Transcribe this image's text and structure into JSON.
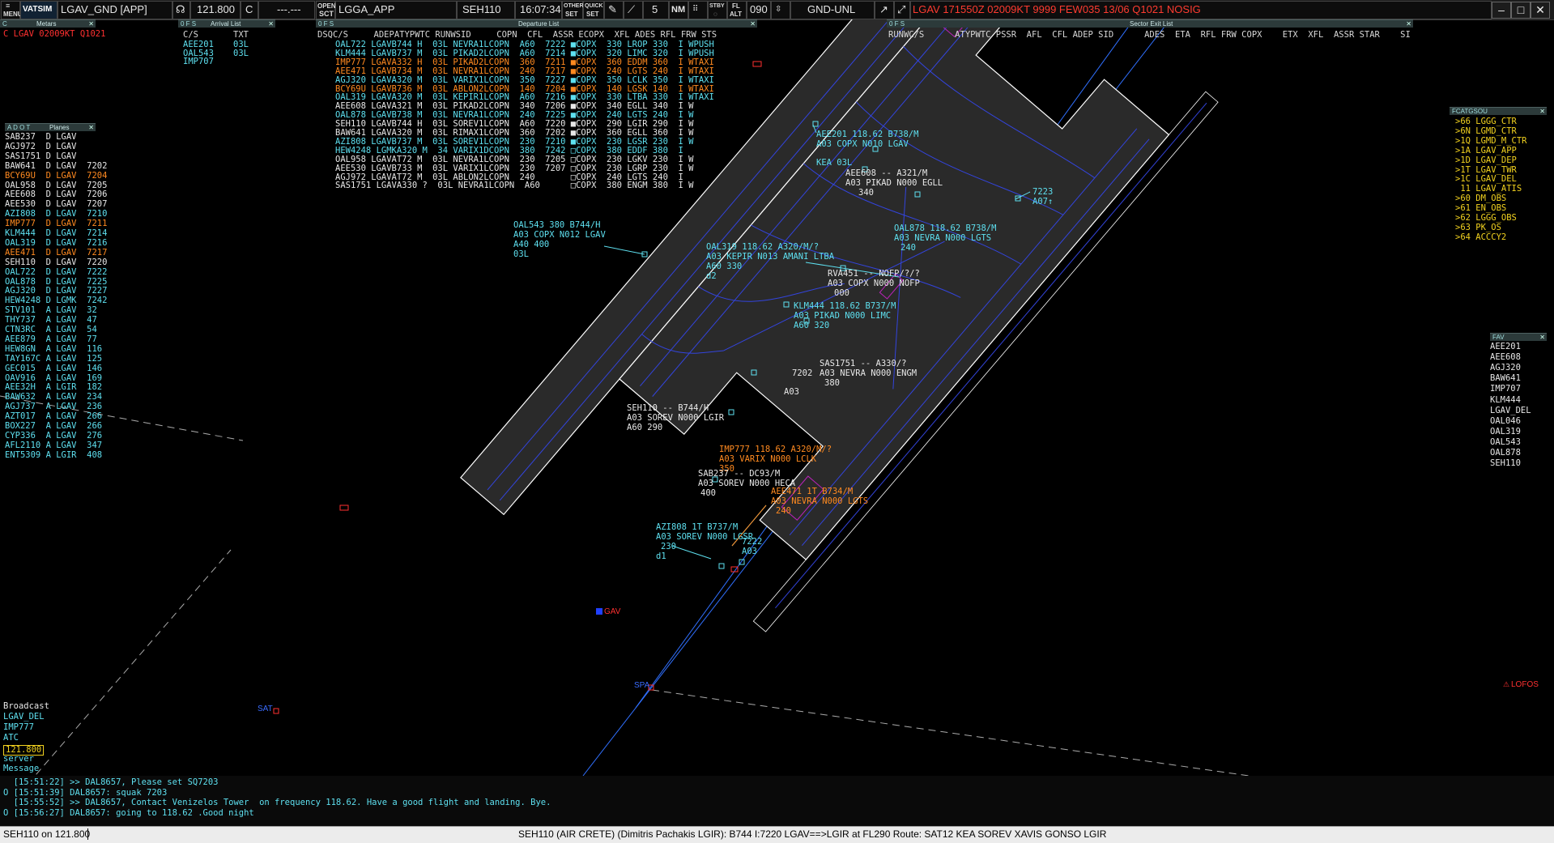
{
  "toolbar": {
    "menu_label": "MENU",
    "logo": "VATSIM",
    "position": "LGAV_GND [APP]",
    "frequency": "121.800",
    "freq_mode": "C",
    "freq_aux": "---.---",
    "open_label": "OPEN",
    "sct_label": "SCT",
    "sector_file": "LGGA_APP",
    "selected_callsign": "SEH110",
    "time": "16:07:34",
    "other_label": "OTHER",
    "set_label": "SET",
    "quick_label": "QUICK",
    "range": "5",
    "nm_label": "NM",
    "stby_label": "STBY",
    "fl_label": "FL",
    "alt_label": "ALT",
    "transition": "090",
    "filter": "GND-UNL",
    "metar": "LGAV 171550Z 02009KT 9999 FEW035 13/06 Q1021 NOSIG",
    "min_icon": "minimize-icon",
    "max_icon": "maximize-icon",
    "close_icon": "close-icon"
  },
  "metars_panel": {
    "header": "Metars",
    "line": "C LGAV 02009KT Q1021"
  },
  "arrival_panel": {
    "header": "Arrival List",
    "col_cs": "C/S",
    "col_txt": "TXT",
    "rows": [
      {
        "cs": "AEE201",
        "txt": "03L"
      },
      {
        "cs": "OAL543",
        "txt": "03L"
      },
      {
        "cs": "IMP707",
        "txt": ""
      }
    ]
  },
  "departure_panel": {
    "header": "Departure List",
    "cols": "DSQC/S     ADEPATYPWTC RUNWSID     COPN  CFL  ASSR ECOPX  XFL ADES RFL FRW STS",
    "rows": [
      {
        "text": "OAL722 LGAVB744 H  03L NEVRA1LCOPN  A60  7222 ■COPX  330 LROP 330  I WPUSH",
        "color": "cyan"
      },
      {
        "text": "KLM444 LGAVB737 M  03L PIKAD2LCOPN  A60  7214 ■COPX  320 LIMC 320  I WPUSH",
        "color": "cyan"
      },
      {
        "text": "IMP777 LGAVA332 H  03L PIKAD2LCOPN  360  7211 ■COPX  360 EDDM 360  I WTAXI",
        "color": "orange"
      },
      {
        "text": "AEE471 LGAVB734 M  03L NEVRA1LCOPN  240  7217 ■COPX  240 LGTS 240  I WTAXI",
        "color": "orange"
      },
      {
        "text": "AGJ320 LGAVA320 M  03L VARIX1LCOPN  350  7227 ■COPX  350 LCLK 350  I WTAXI",
        "color": "cyan"
      },
      {
        "text": "BCY69U LGAVB736 M  03L ABLON2LCOPN  140  7204 ■COPX  140 LGSK 140  I WTAXI",
        "color": "orange"
      },
      {
        "text": "OAL319 LGAVA320 M  03L KEPIR1LCOPN  A60  7216 ■COPX  330 LTBA 330  I WTAXI",
        "color": "cyan"
      },
      {
        "text": "AEE608 LGAVA321 M  03L PIKAD2LCOPN  340  7206 ■COPX  340 EGLL 340  I W",
        "color": "white"
      },
      {
        "text": "OAL878 LGAVB738 M  03L NEVRA1LCOPN  240  7225 ■COPX  240 LGTS 240  I W",
        "color": "cyan"
      },
      {
        "text": "SEH110 LGAVB744 H  03L SOREV1LCOPN  A60  7220 ■COPX  290 LGIR 290  I W",
        "color": "white"
      },
      {
        "text": "BAW641 LGAVA320 M  03L RIMAX1LCOPN  360  7202 ■COPX  360 EGLL 360  I W",
        "color": "white"
      },
      {
        "text": "AZI808 LGAVB737 M  03L SOREV1LCOPN  230  7210 ■COPX  230 LGSR 230  I W",
        "color": "cyan"
      },
      {
        "text": "HEW4248 LGMKA320 M  34 VARIX1DCOPN  380  7242 □COPX  380 EDDF 380  I",
        "color": "cyan"
      },
      {
        "text": "OAL958 LGAVAT72 M  03L NEVRA1LCOPN  230  7205 □COPX  230 LGKV 230  I W",
        "color": "white"
      },
      {
        "text": "AEE530 LGAVB733 M  03L VARIX1LCOPN  230  7207 □COPX  230 LGRP 230  I W",
        "color": "white"
      },
      {
        "text": "AGJ972 LGAVAT72 M  03L ABLON2LCOPN  240       □COPX  240 LGTS 240  I",
        "color": "white"
      },
      {
        "text": "SAS1751 LGAVA330 ?  03L NEVRA1LCOPN  A60      □COPX  380 ENGM 380  I W",
        "color": "white"
      }
    ]
  },
  "sector_panel": {
    "header": "Sector Exit List",
    "cols": "RUNWC/S      ATYPWTC PSSR  AFL  CFL ADEP SID      ADES  ETA  RFL FRW COPX    ETX  XFL  ASSR STAR    SI"
  },
  "planes_panel": {
    "header": "Planes",
    "rows": [
      {
        "text": "SAB237  D LGAV",
        "color": "white"
      },
      {
        "text": "AGJ972  D LGAV",
        "color": "white"
      },
      {
        "text": "SAS1751 D LGAV",
        "color": "white"
      },
      {
        "text": "BAW641  D LGAV  7202",
        "color": "white"
      },
      {
        "text": "BCY69U  D LGAV  7204",
        "color": "orange"
      },
      {
        "text": "OAL958  D LGAV  7205",
        "color": "white"
      },
      {
        "text": "AEE608  D LGAV  7206",
        "color": "white"
      },
      {
        "text": "AEE530  D LGAV  7207",
        "color": "white"
      },
      {
        "text": "AZI808  D LGAV  7210",
        "color": "cyan"
      },
      {
        "text": "IMP777  D LGAV  7211",
        "color": "orange"
      },
      {
        "text": "KLM444  D LGAV  7214",
        "color": "cyan"
      },
      {
        "text": "OAL319  D LGAV  7216",
        "color": "cyan"
      },
      {
        "text": "AEE471  D LGAV  7217",
        "color": "orange"
      },
      {
        "text": "SEH110  D LGAV  7220",
        "color": "white"
      },
      {
        "text": "OAL722  D LGAV  7222",
        "color": "cyan"
      },
      {
        "text": "OAL878  D LGAV  7225",
        "color": "cyan"
      },
      {
        "text": "AGJ320  D LGAV  7227",
        "color": "cyan"
      },
      {
        "text": "HEW4248 D LGMK  7242",
        "color": "cyan"
      },
      {
        "text": "STV101  A LGAV  32",
        "color": "cyan"
      },
      {
        "text": "THY737  A LGAV  47",
        "color": "cyan"
      },
      {
        "text": "CTN3RC  A LGAV  54",
        "color": "cyan"
      },
      {
        "text": "AEE879  A LGAV  77",
        "color": "cyan"
      },
      {
        "text": "HEW8GN  A LGAV  116",
        "color": "cyan"
      },
      {
        "text": "TAY167C A LGAV  125",
        "color": "cyan"
      },
      {
        "text": "GEC015  A LGAV  146",
        "color": "cyan"
      },
      {
        "text": "OAV916  A LGAV  169",
        "color": "cyan"
      },
      {
        "text": "AEE32H  A LGIR  182",
        "color": "cyan"
      },
      {
        "text": "BAW632  A LGAV  234",
        "color": "cyan"
      },
      {
        "text": "AGJ737  A LGAV  236",
        "color": "cyan"
      },
      {
        "text": "AZT017  A LGAV  266",
        "color": "cyan"
      },
      {
        "text": "BOX227  A LGAV  266",
        "color": "cyan"
      },
      {
        "text": "CYP336  A LGAV  276",
        "color": "cyan"
      },
      {
        "text": "AFL2110 A LGAV  347",
        "color": "cyan"
      },
      {
        "text": "ENT5309 A LGIR  408",
        "color": "cyan"
      }
    ]
  },
  "freq_panel": {
    "header": "FCATGSOU",
    "rows": [
      ">66 LGGG_CTR",
      ">6N LGMD_CTR",
      ">1Q LGMD_M_CTR",
      ">1A LGAV_APP",
      ">1D LGAV_DEP",
      ">1T LGAV_TWR",
      ">1C LGAV_DEL",
      " 11 LGAV_ATIS",
      ">60 DM_OBS",
      ">61 EN_OBS",
      ">62 LGGG_OBS",
      ">63 PK_OS",
      ">64 ACCCY2"
    ]
  },
  "fav_panel": {
    "header": "FAV",
    "rows": [
      "AEE201",
      "AEE608",
      "AGJ320",
      "BAW641",
      "IMP707",
      "KLM444",
      "LGAV_DEL",
      "OAL046",
      "OAL319",
      "OAL543",
      "OAL878",
      "SEH110"
    ]
  },
  "broadcast": {
    "title": "Broadcast",
    "rows": [
      "LGAV_DEL",
      "IMP777",
      "ATC"
    ],
    "freq": "121.800",
    "server": "server",
    "message": "Message"
  },
  "messages": [
    {
      "text": "  [15:51:22] >> DAL8657, Please set SQ7203",
      "color": "white"
    },
    {
      "text": "O [15:51:39] DAL8657: squak 7203",
      "color": "cyan"
    },
    {
      "text": "  [15:55:52] >> DAL8657, Contact Venizelos Tower  on frequency 118.62. Have a good flight and landing. Bye.",
      "color": "white"
    },
    {
      "text": "O [15:56:27] DAL8657: going to 118.62 .Good night",
      "color": "cyan"
    }
  ],
  "status": {
    "command": "SEH110 on 121.800",
    "info": "SEH110 (AIR CRETE) (Dimitris  Pachakis  LGIR): B744 I:7220 LGAV==>LGIR at FL290 Route: SAT12 KEA SOREV XAVIS GONSO LGIR"
  },
  "radar_labels": [
    {
      "t": "AEE201 118.62 B738/M",
      "c": "#5ee0f0"
    },
    {
      "t": "A03 COPX N010 LGAV",
      "c": "#5ee0f0"
    },
    {
      "t": "KEA 03L",
      "c": "#5ee0f0"
    },
    {
      "t": "AEE608  --  A321/M",
      "c": "#e8e8e8"
    },
    {
      "t": "A03 PIKAD N000 EGLL",
      "c": "#e8e8e8"
    },
    {
      "t": "340",
      "c": "#e8e8e8"
    },
    {
      "t": "OAL878 118.62 B738/M",
      "c": "#5ee0f0"
    },
    {
      "t": "A03 NEVRA N000 LGTS",
      "c": "#5ee0f0"
    },
    {
      "t": "240",
      "c": "#5ee0f0"
    },
    {
      "t": "OAL543  380  B744/H",
      "c": "#5ee0f0"
    },
    {
      "t": "A03 COPX N012 LGAV",
      "c": "#5ee0f0"
    },
    {
      "t": "A40 400",
      "c": "#5ee0f0"
    },
    {
      "t": "03L",
      "c": "#5ee0f0"
    },
    {
      "t": "OAL319 118.62 A320/M/?",
      "c": "#5ee0f0"
    },
    {
      "t": "A03 KEPIR N013 AMANI LTBA",
      "c": "#5ee0f0"
    },
    {
      "t": "A60 330",
      "c": "#5ee0f0"
    },
    {
      "t": "d2",
      "c": "#5ee0f0"
    },
    {
      "t": "RVA451 -- NOFP/?/?",
      "c": "#e8e8e8"
    },
    {
      "t": "A03 COPX N000 NOFP",
      "c": "#e8e8e8"
    },
    {
      "t": "000",
      "c": "#e8e8e8"
    },
    {
      "t": "KLM444 118.62 B737/M",
      "c": "#5ee0f0"
    },
    {
      "t": "A03 PIKAD N000 LIMC",
      "c": "#5ee0f0"
    },
    {
      "t": "A60 320",
      "c": "#5ee0f0"
    },
    {
      "t": "SAS1751 -- A330/?",
      "c": "#e8e8e8"
    },
    {
      "t": "A03 NEVRA N000 ENGM",
      "c": "#e8e8e8"
    },
    {
      "t": "380",
      "c": "#e8e8e8"
    },
    {
      "t": "7202",
      "c": "#e8e8e8"
    },
    {
      "t": "A03",
      "c": "#e8e8e8"
    },
    {
      "t": "SEH110 -- B744/H",
      "c": "#e8e8e8"
    },
    {
      "t": "A03 SOREV N000 LGIR",
      "c": "#e8e8e8"
    },
    {
      "t": "A60 290",
      "c": "#e8e8e8"
    },
    {
      "t": "IMP777 118.62 A320/M/?",
      "c": "#ff8a20"
    },
    {
      "t": "A03 VARIX N000 LCLK",
      "c": "#ff8a20"
    },
    {
      "t": "350",
      "c": "#ff8a20"
    },
    {
      "t": "SAB237 -- DC93/M",
      "c": "#e8e8e8"
    },
    {
      "t": "A03 SOREV N000 HECA",
      "c": "#e8e8e8"
    },
    {
      "t": "400",
      "c": "#e8e8e8"
    },
    {
      "t": "AEE471 1T B734/M",
      "c": "#ff8a20"
    },
    {
      "t": "A03 NEVRA N000 LGTS",
      "c": "#ff8a20"
    },
    {
      "t": "240",
      "c": "#ff8a20"
    },
    {
      "t": "AZI808 1T B737/M",
      "c": "#5ee0f0"
    },
    {
      "t": "A03 SOREV N000 LGSR",
      "c": "#5ee0f0"
    },
    {
      "t": "230",
      "c": "#5ee0f0"
    },
    {
      "t": "d1",
      "c": "#5ee0f0"
    },
    {
      "t": "7222",
      "c": "#5ee0f0"
    },
    {
      "t": "A03",
      "c": "#5ee0f0"
    },
    {
      "t": "7223",
      "c": "#5ee0f0"
    },
    {
      "t": "A07↑",
      "c": "#5ee0f0"
    }
  ],
  "radar_marks": {
    "lofos": "LOFOS",
    "sat": "SAT",
    "spa": "SPA",
    "gav": "GAV"
  }
}
